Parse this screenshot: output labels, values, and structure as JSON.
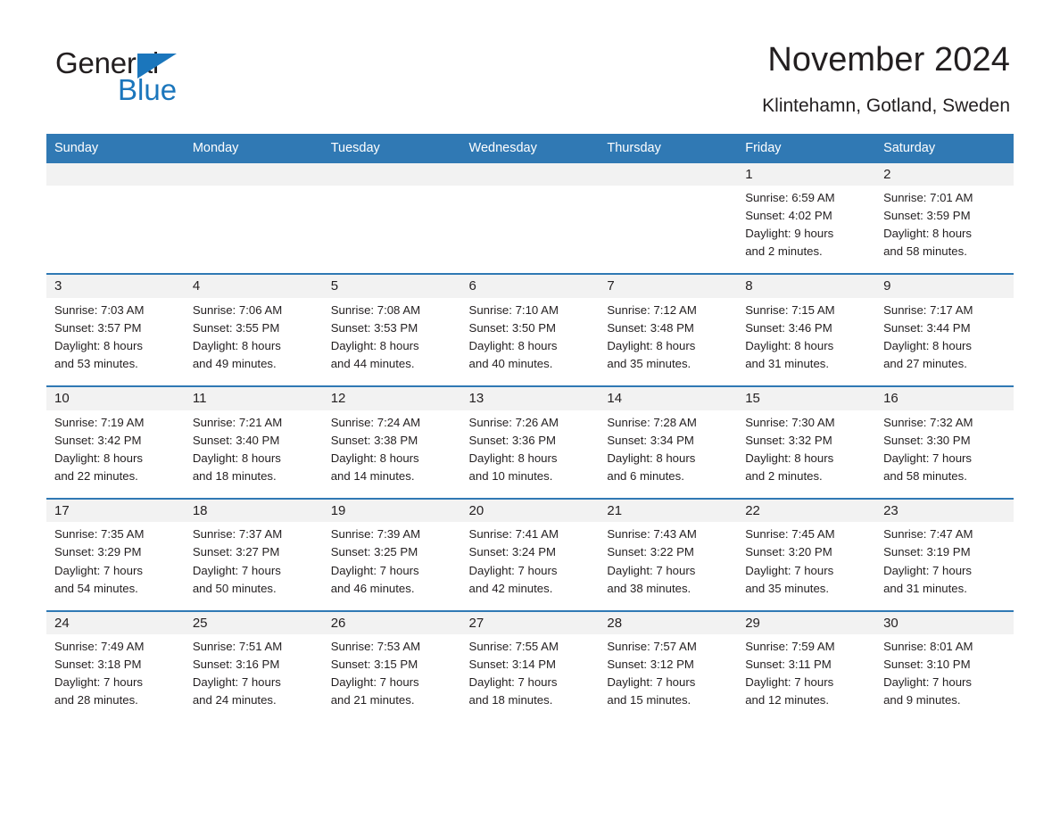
{
  "brand": {
    "name_part1": "General",
    "name_part2": "Blue",
    "logo_icon": "triangle-icon"
  },
  "header": {
    "month_title": "November 2024",
    "location": "Klintehamn, Gotland, Sweden"
  },
  "colors": {
    "header_blue": "#3079b4",
    "brand_blue": "#1b76bc",
    "daynum_band": "#f2f2f2",
    "text": "#231f20"
  },
  "calendar": {
    "weekday_headers": [
      "Sunday",
      "Monday",
      "Tuesday",
      "Wednesday",
      "Thursday",
      "Friday",
      "Saturday"
    ],
    "weeks": [
      [
        {
          "day": "",
          "sunrise": "",
          "sunset": "",
          "daylight_line1": "",
          "daylight_line2": ""
        },
        {
          "day": "",
          "sunrise": "",
          "sunset": "",
          "daylight_line1": "",
          "daylight_line2": ""
        },
        {
          "day": "",
          "sunrise": "",
          "sunset": "",
          "daylight_line1": "",
          "daylight_line2": ""
        },
        {
          "day": "",
          "sunrise": "",
          "sunset": "",
          "daylight_line1": "",
          "daylight_line2": ""
        },
        {
          "day": "",
          "sunrise": "",
          "sunset": "",
          "daylight_line1": "",
          "daylight_line2": ""
        },
        {
          "day": "1",
          "sunrise": "Sunrise: 6:59 AM",
          "sunset": "Sunset: 4:02 PM",
          "daylight_line1": "Daylight: 9 hours",
          "daylight_line2": "and 2 minutes."
        },
        {
          "day": "2",
          "sunrise": "Sunrise: 7:01 AM",
          "sunset": "Sunset: 3:59 PM",
          "daylight_line1": "Daylight: 8 hours",
          "daylight_line2": "and 58 minutes."
        }
      ],
      [
        {
          "day": "3",
          "sunrise": "Sunrise: 7:03 AM",
          "sunset": "Sunset: 3:57 PM",
          "daylight_line1": "Daylight: 8 hours",
          "daylight_line2": "and 53 minutes."
        },
        {
          "day": "4",
          "sunrise": "Sunrise: 7:06 AM",
          "sunset": "Sunset: 3:55 PM",
          "daylight_line1": "Daylight: 8 hours",
          "daylight_line2": "and 49 minutes."
        },
        {
          "day": "5",
          "sunrise": "Sunrise: 7:08 AM",
          "sunset": "Sunset: 3:53 PM",
          "daylight_line1": "Daylight: 8 hours",
          "daylight_line2": "and 44 minutes."
        },
        {
          "day": "6",
          "sunrise": "Sunrise: 7:10 AM",
          "sunset": "Sunset: 3:50 PM",
          "daylight_line1": "Daylight: 8 hours",
          "daylight_line2": "and 40 minutes."
        },
        {
          "day": "7",
          "sunrise": "Sunrise: 7:12 AM",
          "sunset": "Sunset: 3:48 PM",
          "daylight_line1": "Daylight: 8 hours",
          "daylight_line2": "and 35 minutes."
        },
        {
          "day": "8",
          "sunrise": "Sunrise: 7:15 AM",
          "sunset": "Sunset: 3:46 PM",
          "daylight_line1": "Daylight: 8 hours",
          "daylight_line2": "and 31 minutes."
        },
        {
          "day": "9",
          "sunrise": "Sunrise: 7:17 AM",
          "sunset": "Sunset: 3:44 PM",
          "daylight_line1": "Daylight: 8 hours",
          "daylight_line2": "and 27 minutes."
        }
      ],
      [
        {
          "day": "10",
          "sunrise": "Sunrise: 7:19 AM",
          "sunset": "Sunset: 3:42 PM",
          "daylight_line1": "Daylight: 8 hours",
          "daylight_line2": "and 22 minutes."
        },
        {
          "day": "11",
          "sunrise": "Sunrise: 7:21 AM",
          "sunset": "Sunset: 3:40 PM",
          "daylight_line1": "Daylight: 8 hours",
          "daylight_line2": "and 18 minutes."
        },
        {
          "day": "12",
          "sunrise": "Sunrise: 7:24 AM",
          "sunset": "Sunset: 3:38 PM",
          "daylight_line1": "Daylight: 8 hours",
          "daylight_line2": "and 14 minutes."
        },
        {
          "day": "13",
          "sunrise": "Sunrise: 7:26 AM",
          "sunset": "Sunset: 3:36 PM",
          "daylight_line1": "Daylight: 8 hours",
          "daylight_line2": "and 10 minutes."
        },
        {
          "day": "14",
          "sunrise": "Sunrise: 7:28 AM",
          "sunset": "Sunset: 3:34 PM",
          "daylight_line1": "Daylight: 8 hours",
          "daylight_line2": "and 6 minutes."
        },
        {
          "day": "15",
          "sunrise": "Sunrise: 7:30 AM",
          "sunset": "Sunset: 3:32 PM",
          "daylight_line1": "Daylight: 8 hours",
          "daylight_line2": "and 2 minutes."
        },
        {
          "day": "16",
          "sunrise": "Sunrise: 7:32 AM",
          "sunset": "Sunset: 3:30 PM",
          "daylight_line1": "Daylight: 7 hours",
          "daylight_line2": "and 58 minutes."
        }
      ],
      [
        {
          "day": "17",
          "sunrise": "Sunrise: 7:35 AM",
          "sunset": "Sunset: 3:29 PM",
          "daylight_line1": "Daylight: 7 hours",
          "daylight_line2": "and 54 minutes."
        },
        {
          "day": "18",
          "sunrise": "Sunrise: 7:37 AM",
          "sunset": "Sunset: 3:27 PM",
          "daylight_line1": "Daylight: 7 hours",
          "daylight_line2": "and 50 minutes."
        },
        {
          "day": "19",
          "sunrise": "Sunrise: 7:39 AM",
          "sunset": "Sunset: 3:25 PM",
          "daylight_line1": "Daylight: 7 hours",
          "daylight_line2": "and 46 minutes."
        },
        {
          "day": "20",
          "sunrise": "Sunrise: 7:41 AM",
          "sunset": "Sunset: 3:24 PM",
          "daylight_line1": "Daylight: 7 hours",
          "daylight_line2": "and 42 minutes."
        },
        {
          "day": "21",
          "sunrise": "Sunrise: 7:43 AM",
          "sunset": "Sunset: 3:22 PM",
          "daylight_line1": "Daylight: 7 hours",
          "daylight_line2": "and 38 minutes."
        },
        {
          "day": "22",
          "sunrise": "Sunrise: 7:45 AM",
          "sunset": "Sunset: 3:20 PM",
          "daylight_line1": "Daylight: 7 hours",
          "daylight_line2": "and 35 minutes."
        },
        {
          "day": "23",
          "sunrise": "Sunrise: 7:47 AM",
          "sunset": "Sunset: 3:19 PM",
          "daylight_line1": "Daylight: 7 hours",
          "daylight_line2": "and 31 minutes."
        }
      ],
      [
        {
          "day": "24",
          "sunrise": "Sunrise: 7:49 AM",
          "sunset": "Sunset: 3:18 PM",
          "daylight_line1": "Daylight: 7 hours",
          "daylight_line2": "and 28 minutes."
        },
        {
          "day": "25",
          "sunrise": "Sunrise: 7:51 AM",
          "sunset": "Sunset: 3:16 PM",
          "daylight_line1": "Daylight: 7 hours",
          "daylight_line2": "and 24 minutes."
        },
        {
          "day": "26",
          "sunrise": "Sunrise: 7:53 AM",
          "sunset": "Sunset: 3:15 PM",
          "daylight_line1": "Daylight: 7 hours",
          "daylight_line2": "and 21 minutes."
        },
        {
          "day": "27",
          "sunrise": "Sunrise: 7:55 AM",
          "sunset": "Sunset: 3:14 PM",
          "daylight_line1": "Daylight: 7 hours",
          "daylight_line2": "and 18 minutes."
        },
        {
          "day": "28",
          "sunrise": "Sunrise: 7:57 AM",
          "sunset": "Sunset: 3:12 PM",
          "daylight_line1": "Daylight: 7 hours",
          "daylight_line2": "and 15 minutes."
        },
        {
          "day": "29",
          "sunrise": "Sunrise: 7:59 AM",
          "sunset": "Sunset: 3:11 PM",
          "daylight_line1": "Daylight: 7 hours",
          "daylight_line2": "and 12 minutes."
        },
        {
          "day": "30",
          "sunrise": "Sunrise: 8:01 AM",
          "sunset": "Sunset: 3:10 PM",
          "daylight_line1": "Daylight: 7 hours",
          "daylight_line2": "and 9 minutes."
        }
      ]
    ]
  }
}
